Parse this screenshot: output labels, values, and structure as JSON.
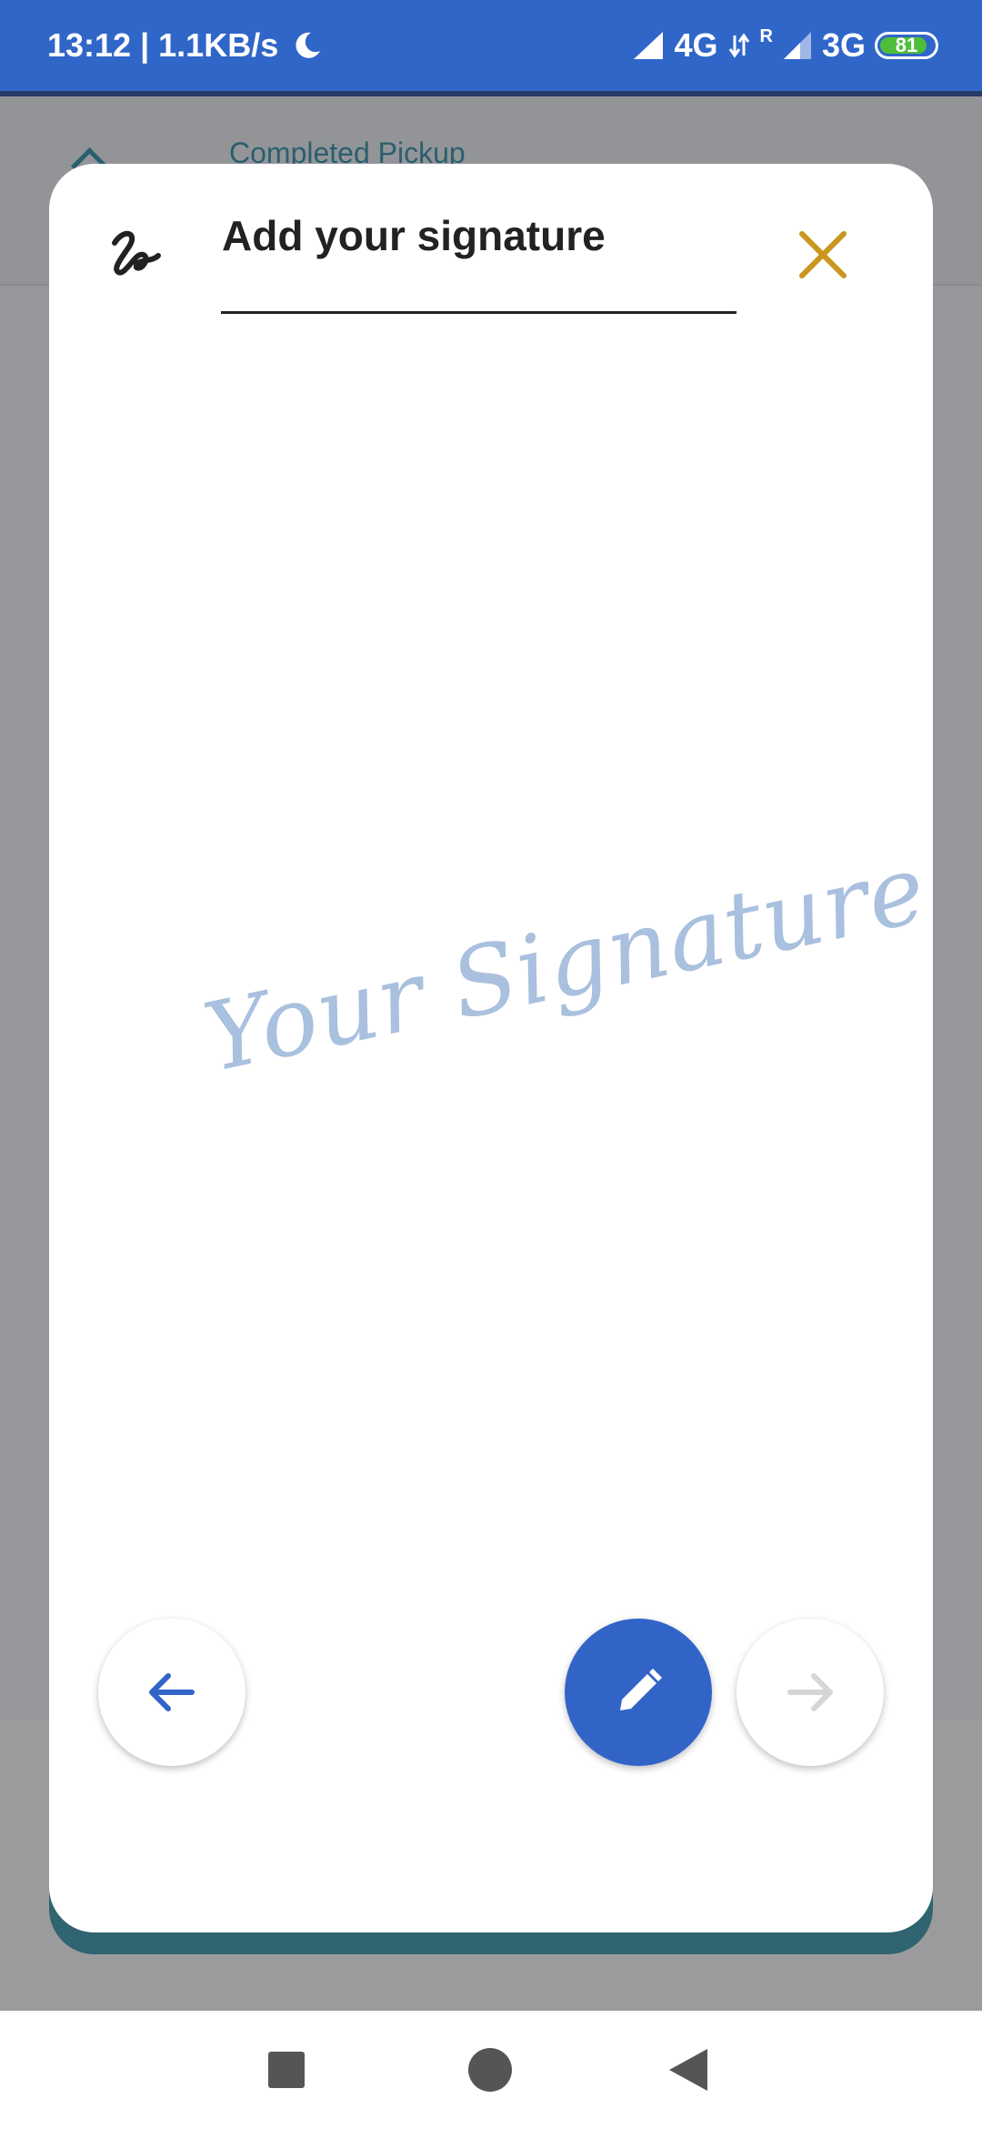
{
  "status_bar": {
    "time_speed": "13:12 | 1.1KB/s",
    "network_1": "4G",
    "network_2": "3G",
    "roaming": "R",
    "battery": "81"
  },
  "background": {
    "title": "Completed Pickup"
  },
  "modal": {
    "title": "Add your signature",
    "placeholder": "Your Signature"
  },
  "colors": {
    "accent": "#3264c8",
    "close": "#c9961e",
    "placeholder": "#a9c0de"
  },
  "icons": {
    "logo": "signature-logo-icon",
    "close": "close-icon",
    "back": "arrow-left-icon",
    "edit": "pencil-icon",
    "next": "arrow-right-icon"
  }
}
